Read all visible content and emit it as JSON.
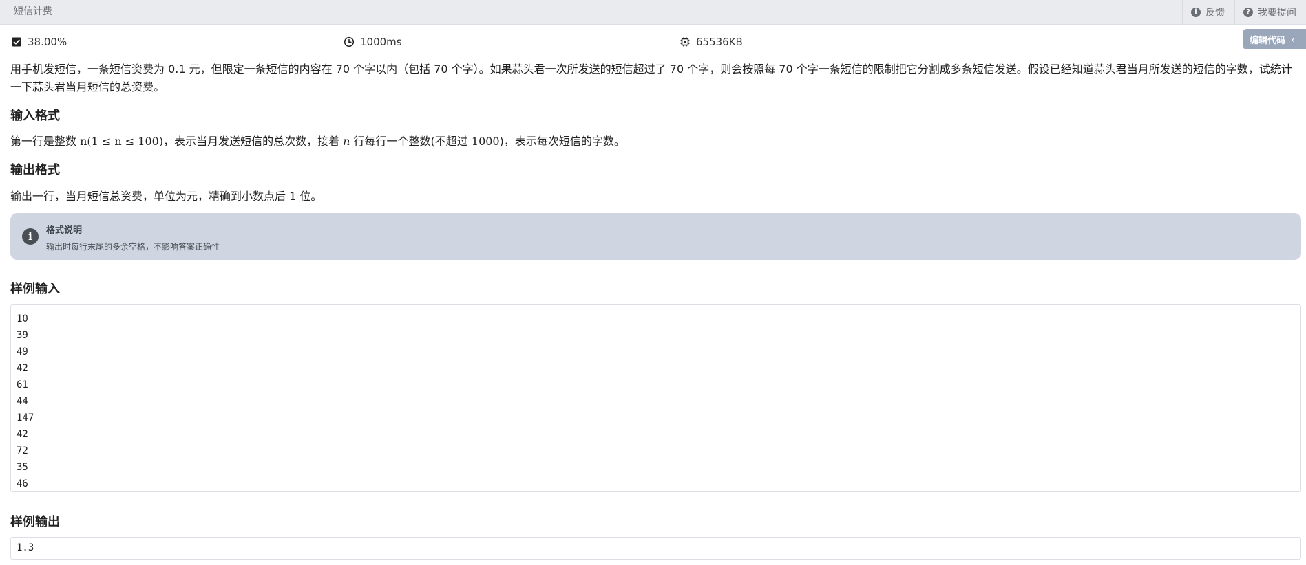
{
  "header": {
    "title": "短信计费",
    "feedback_label": "反馈",
    "ask_label": "我要提问",
    "feedback_icon": "info-icon",
    "ask_icon": "question-icon"
  },
  "stats": {
    "pass_rate": "38.00%",
    "time_limit": "1000ms",
    "memory_limit": "65536KB"
  },
  "edit_button": {
    "label": "编辑代码",
    "chevron": "‹"
  },
  "problem": {
    "description": "用手机发短信，一条短信资费为 0.1 元，但限定一条短信的内容在 70 个字以内（包括 70 个字）。如果蒜头君一次所发送的短信超过了 70 个字，则会按照每 70 个字一条短信的限制把它分割成多条短信发送。假设已经知道蒜头君当月所发送的短信的字数，试统计一下蒜头君当月短信的总资费。",
    "input_heading": "输入格式",
    "input_pre": "第一行是整数 ",
    "input_math": "n(1 ≤ n ≤ 100)",
    "input_mid": "，表示当月发送短信的总次数，接着 ",
    "input_var": "n",
    "input_mid2": " 行每行一个整数(不超过 ",
    "input_num": "1000",
    "input_post": ")，表示每次短信的字数。",
    "output_heading": "输出格式",
    "output_text": "输出一行，当月短信总资费，单位为元，精确到小数点后 1 位。"
  },
  "notice": {
    "title": "格式说明",
    "text": "输出时每行末尾的多余空格，不影响答案正确性"
  },
  "sample_input": {
    "heading": "样例输入",
    "lines": [
      "10",
      "39",
      "49",
      "42",
      "61",
      "44",
      "147",
      "42",
      "72",
      "35",
      "46"
    ]
  },
  "sample_output": {
    "heading": "样例输出",
    "value": "1.3"
  }
}
